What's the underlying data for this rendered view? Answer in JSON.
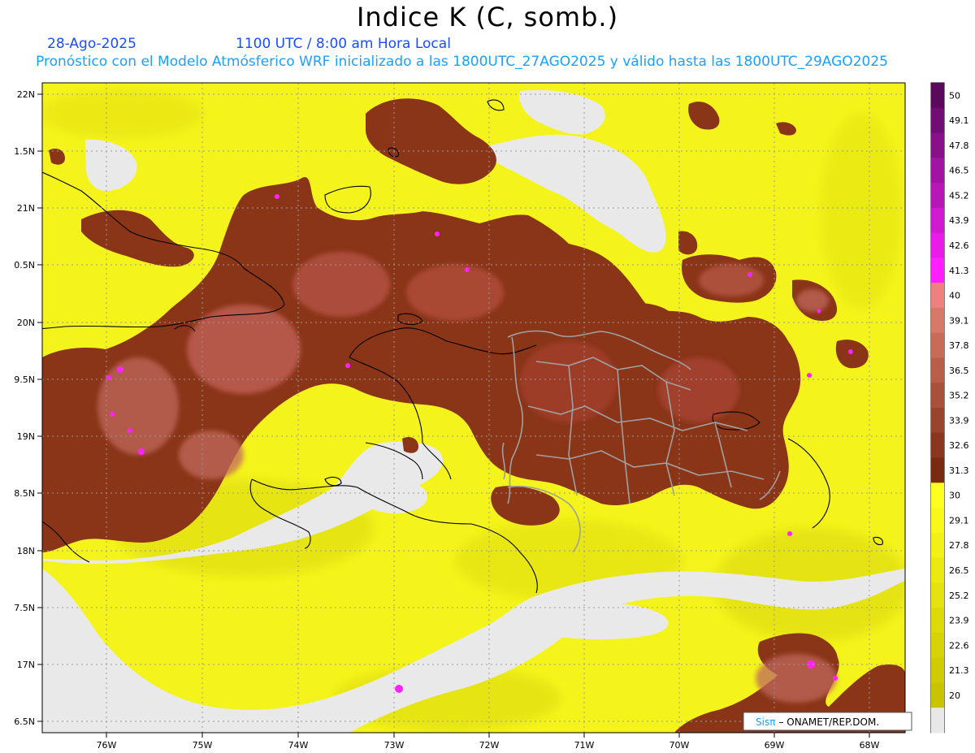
{
  "header": {
    "title": "Indice K (C, somb.)",
    "date": "28-Ago-2025",
    "time": "1100 UTC / 8:00 am Hora Local",
    "model_line": "Pronóstico con el Modelo Atmósferico WRF inicializado a las 1800UTC_27AGO2025 y válido hasta las  1800UTC_29AGO2025"
  },
  "axes": {
    "lat_labels": [
      "22N",
      "1.5N",
      "21N",
      "0.5N",
      "20N",
      "9.5N",
      "19N",
      "8.5N",
      "18N",
      "7.5N",
      "17N",
      "6.5N"
    ],
    "lon_labels": [
      "76W",
      "75W",
      "74W",
      "73W",
      "72W",
      "71W",
      "70W",
      "69W",
      "68W"
    ]
  },
  "colorbar": {
    "labels": [
      "50",
      "49.1",
      "47.8",
      "46.5",
      "45.2",
      "43.9",
      "42.6",
      "41.3",
      "40",
      "39.1",
      "37.8",
      "36.5",
      "35.2",
      "33.9",
      "32.6",
      "31.3",
      "30",
      "29.1",
      "27.8",
      "26.5",
      "25.2",
      "23.9",
      "22.6",
      "21.3",
      "20"
    ],
    "colors": {
      "below_20": "#e8e8e8",
      "yellow_low": "#c8c400",
      "yellow_high": "#ffff20",
      "brown_low": "#7a2a10",
      "brown_high": "#d87868",
      "pink": "#f08080",
      "magenta_low": "#ff20ff",
      "purple_high": "#5a0a5a"
    }
  },
  "credit": {
    "brand": "Sisπ",
    "source": "– ONAMET/REP.DOM."
  }
}
